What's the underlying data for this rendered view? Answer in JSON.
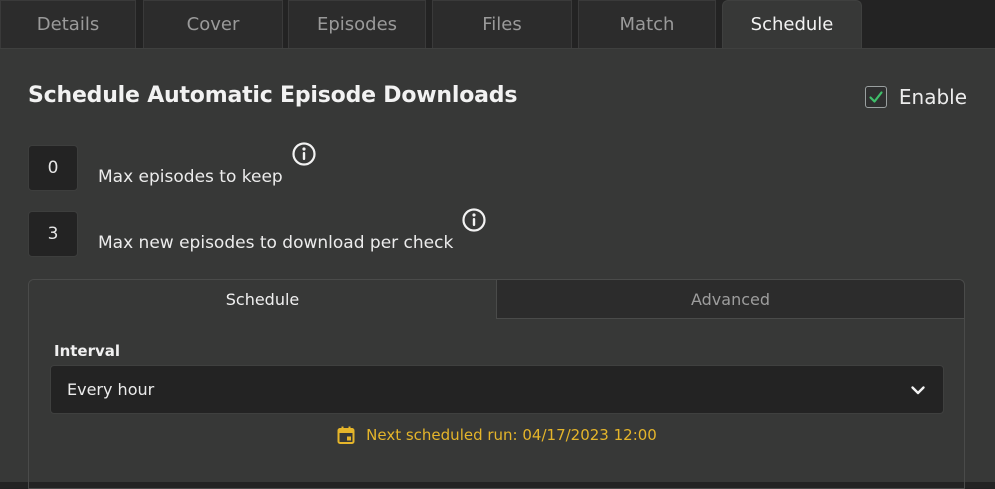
{
  "tabs": [
    {
      "label": "Details"
    },
    {
      "label": "Cover"
    },
    {
      "label": "Episodes"
    },
    {
      "label": "Files"
    },
    {
      "label": "Match"
    },
    {
      "label": "Schedule"
    }
  ],
  "active_tab": "Schedule",
  "heading": "Schedule Automatic Episode Downloads",
  "enable": {
    "label": "Enable",
    "checked": true
  },
  "max_keep": {
    "value": "0",
    "label": "Max episodes to keep"
  },
  "max_new": {
    "value": "3",
    "label": "Max new episodes to download per check"
  },
  "subtabs": [
    {
      "label": "Schedule"
    },
    {
      "label": "Advanced"
    }
  ],
  "interval": {
    "label": "Interval",
    "value": "Every hour"
  },
  "next_run": "Next scheduled run: 04/17/2023 12:00",
  "colors": {
    "accent_green": "#3fbf6a",
    "warning_yellow": "#e5b52a"
  },
  "icons": [
    "info-icon",
    "check-icon",
    "chevron-down-icon",
    "calendar-icon"
  ]
}
